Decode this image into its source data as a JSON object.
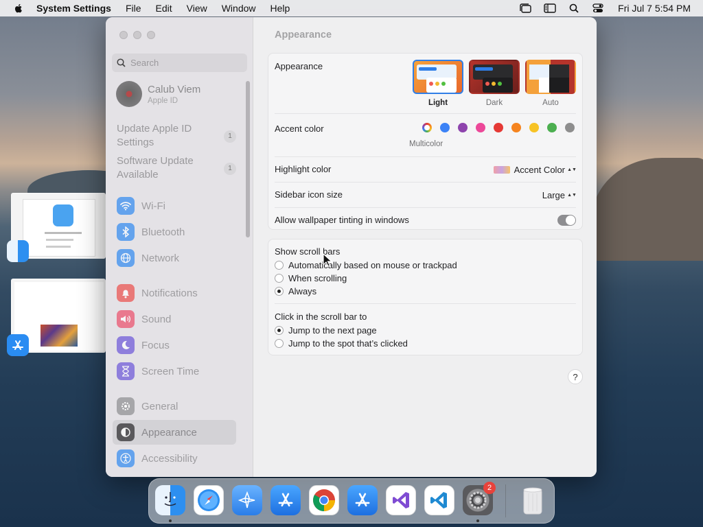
{
  "menubar": {
    "app": "System Settings",
    "items": [
      "File",
      "Edit",
      "View",
      "Window",
      "Help"
    ],
    "clock": "Fri Jul 7  5:54 PM"
  },
  "sidebar": {
    "search_placeholder": "Search",
    "account": {
      "name": "Calub Viem",
      "sub": "Apple ID"
    },
    "updates": [
      {
        "label": "Update Apple ID Settings",
        "badge": "1"
      },
      {
        "label": "Software Update Available",
        "badge": "1"
      }
    ],
    "items": [
      {
        "label": "Wi-Fi",
        "icon": "wifi-icon",
        "color": "#3a8ff0"
      },
      {
        "label": "Bluetooth",
        "icon": "bluetooth-icon",
        "color": "#3a8ff0"
      },
      {
        "label": "Network",
        "icon": "globe-icon",
        "color": "#3a8ff0"
      },
      {
        "label": "Notifications",
        "icon": "bell-icon",
        "color": "#ec4e4a"
      },
      {
        "label": "Sound",
        "icon": "speaker-icon",
        "color": "#ec4e6a"
      },
      {
        "label": "Focus",
        "icon": "moon-icon",
        "color": "#6a55d8"
      },
      {
        "label": "Screen Time",
        "icon": "hourglass-icon",
        "color": "#6a55d8"
      },
      {
        "label": "General",
        "icon": "gear-icon",
        "color": "#9a9a9d"
      },
      {
        "label": "Appearance",
        "icon": "appearance-icon",
        "color": "#1f1f1f"
      },
      {
        "label": "Accessibility",
        "icon": "accessibility-icon",
        "color": "#3a8ff0"
      }
    ]
  },
  "main": {
    "title": "Appearance",
    "appearance": {
      "label": "Appearance",
      "options": [
        "Light",
        "Dark",
        "Auto"
      ],
      "selected": "Light"
    },
    "accent": {
      "label": "Accent color",
      "selected_name": "Multicolor",
      "colors": [
        "#3b82f6",
        "#8e44ad",
        "#ec4899",
        "#e53935",
        "#f5841f",
        "#f7c325",
        "#4caf50",
        "#8e8e8e"
      ]
    },
    "highlight": {
      "label": "Highlight color",
      "value": "Accent Color"
    },
    "icon_size": {
      "label": "Sidebar icon size",
      "value": "Large"
    },
    "tinting": {
      "label": "Allow wallpaper tinting in windows",
      "on": true
    },
    "scroll": {
      "label": "Show scroll bars",
      "options": [
        "Automatically based on mouse or trackpad",
        "When scrolling",
        "Always"
      ],
      "selected": 2
    },
    "click": {
      "label": "Click in the scroll bar to",
      "options": [
        "Jump to the next page",
        "Jump to the spot that’s clicked"
      ],
      "selected": 0
    },
    "help": "?"
  },
  "dock": {
    "settings_badge": "2"
  }
}
